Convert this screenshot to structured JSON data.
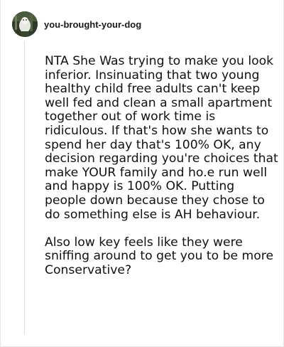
{
  "post": {
    "username": "you-brought-your-dog",
    "avatar_icon": "dog-photo-avatar",
    "paragraphs": [
      "NTA She Was trying to make you look inferior. Insinuating that two young healthy child free adults can't keep well fed and clean a small apartment together out of work time is ridiculous. If that's how she wants to spend her day that's 100% OK, any decision regarding you're choices that make YOUR family and ho.e run well and happy is 100% OK. Putting people down because they chose to do something else is AH behaviour.",
      "Also low key feels like they were sniffing around to get you to be more Conservative?"
    ]
  }
}
